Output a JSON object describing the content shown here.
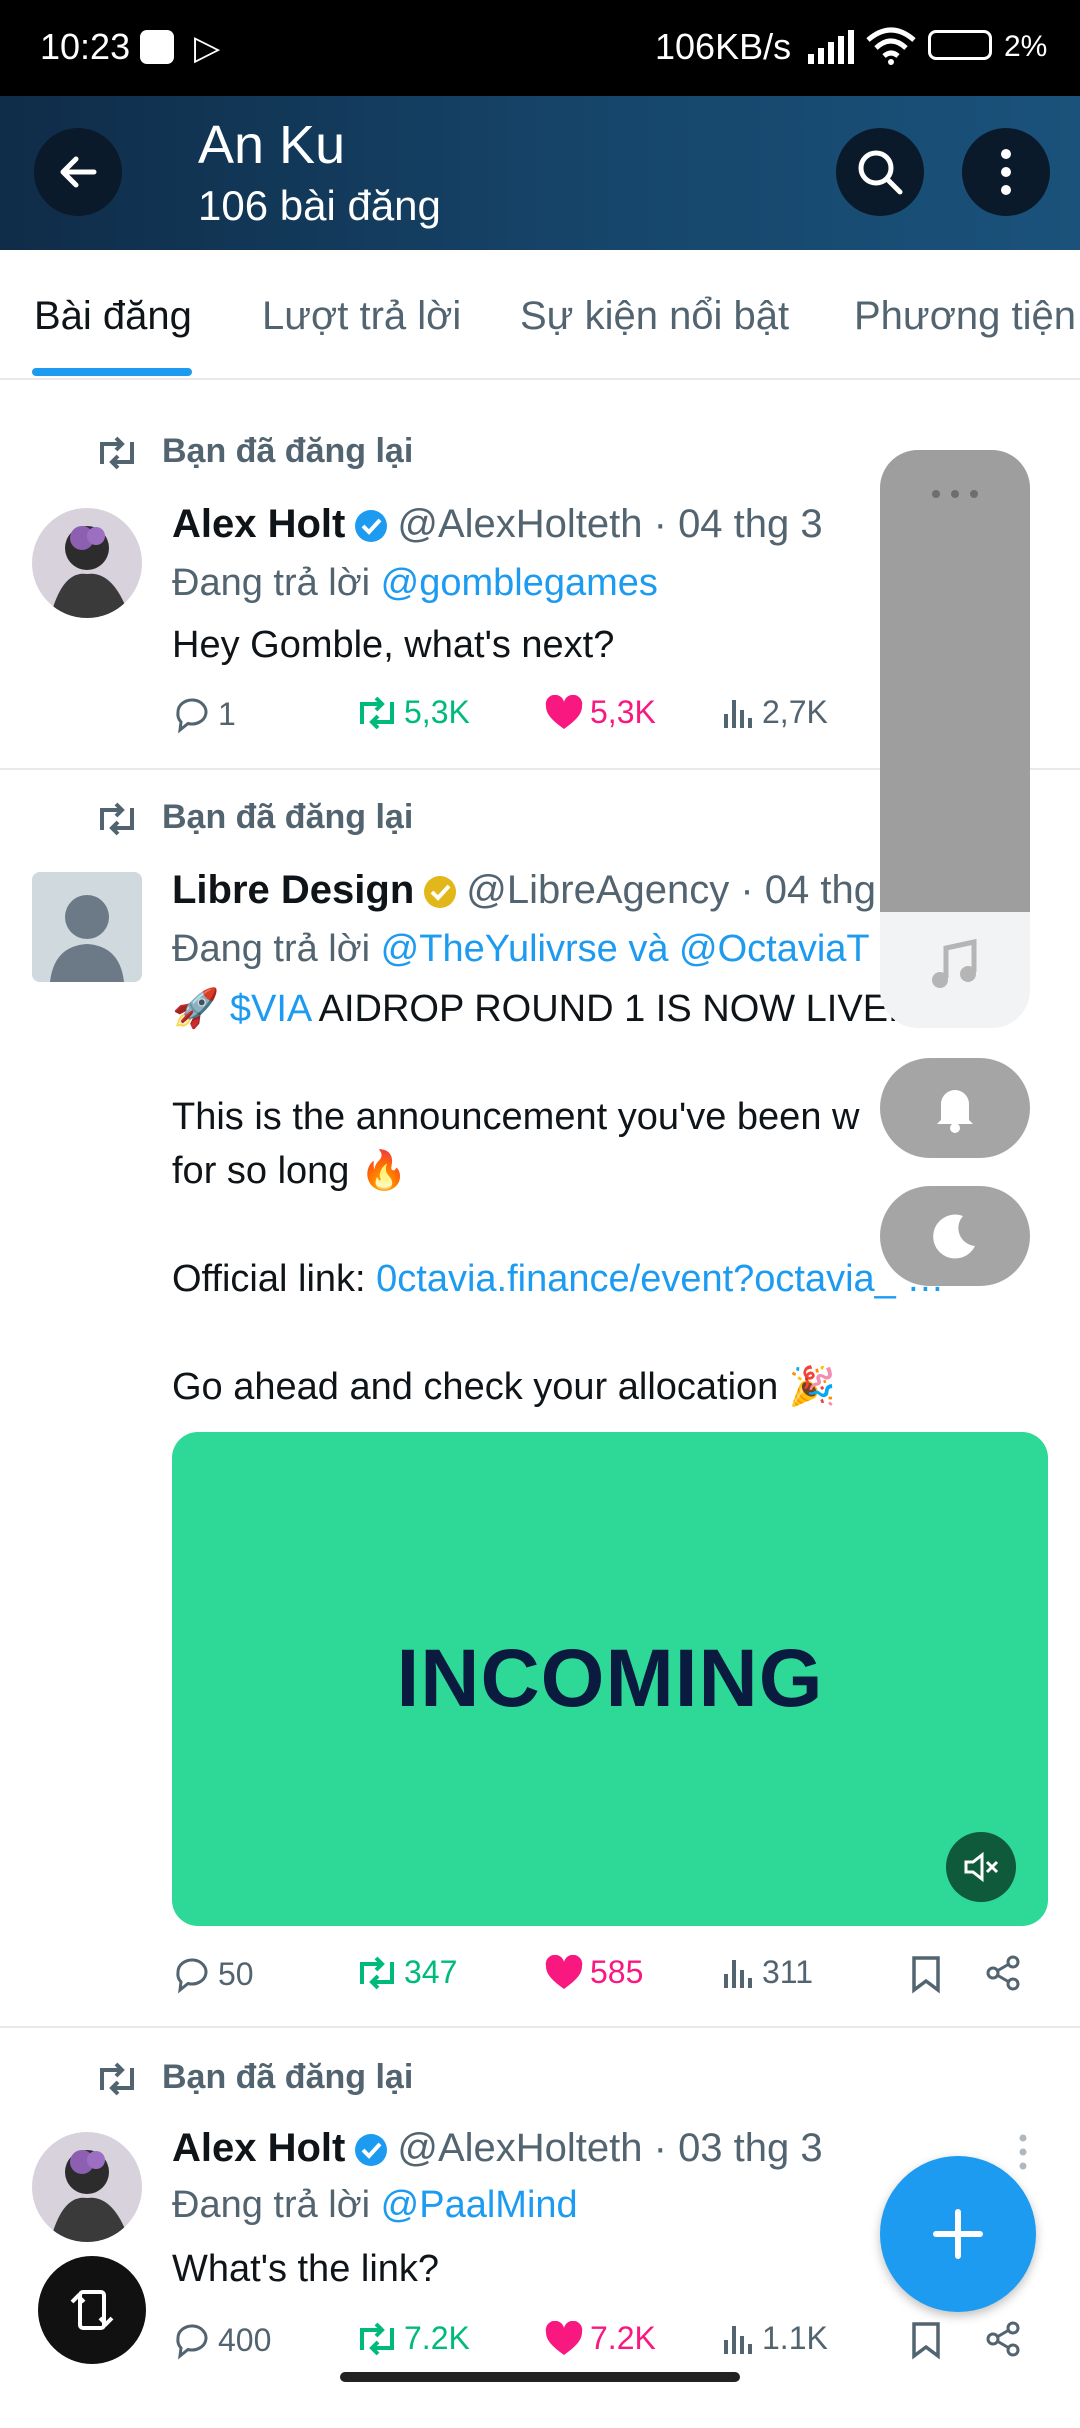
{
  "status": {
    "time": "10:23",
    "speed": "106KB/s",
    "battery": "2%"
  },
  "header": {
    "name": "An Ku",
    "post_count": "106 bài đăng"
  },
  "tabs": [
    {
      "label": "Bài đăng"
    },
    {
      "label": "Lượt trả lời"
    },
    {
      "label": "Sự kiện nổi bật"
    },
    {
      "label": "Phương tiện"
    }
  ],
  "posts": [
    {
      "repost_label": "Bạn đã đăng lại",
      "name": "Alex Holt",
      "handle": "@AlexHolteth · 04 thg 3",
      "reply_prefix": "Đang trả lời ",
      "reply_to": "@gomblegames",
      "text": "Hey Gomble, what's next?",
      "replies": "1",
      "reposts": "5,3K",
      "likes": "5,3K",
      "views": "2,7K"
    },
    {
      "repost_label": "Bạn đã đăng lại",
      "name": "Libre Design",
      "handle": "@LibreAgency · 04 thg 3",
      "reply_prefix": "Đang trả lời ",
      "reply_to": "@TheYulivrse và @OctaviaT",
      "line1_emoji": "🚀",
      "line1_link": "$VIA",
      "line1_rest": " AIDROP ROUND 1 IS NOW LIVE.",
      "line2": "This is the announcement you've been w",
      "line3": "for so long 🔥",
      "line4_prefix": "Official link: ",
      "line4_link": "0ctavia.finance/event?octavia_",
      "line4_more": "…",
      "line5": "Go ahead and check your allocation 🎉",
      "media_text": "INCOMING",
      "replies": "50",
      "reposts": "347",
      "likes": "585",
      "views": "311"
    },
    {
      "repost_label": "Bạn đã đăng lại",
      "name": "Alex Holt",
      "handle": "@AlexHolteth · 03 thg 3",
      "reply_prefix": "Đang trả lời ",
      "reply_to": "@PaalMind",
      "text": "What's the link?",
      "replies": "400",
      "reposts": "7.2K",
      "likes": "7.2K",
      "views": "1.1K"
    }
  ],
  "colors": {
    "accent": "#1d9bf0",
    "repost": "#00ba7c",
    "like": "#f91880",
    "media_bg": "#2ed897"
  }
}
